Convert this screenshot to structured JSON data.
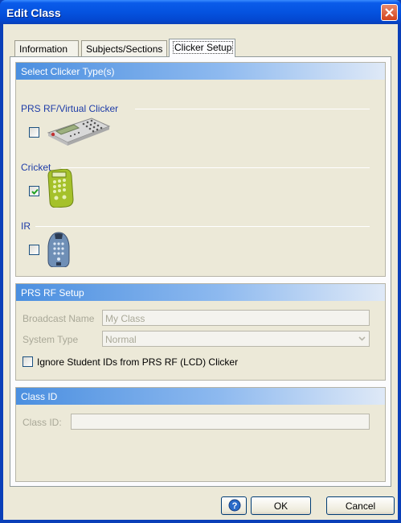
{
  "window": {
    "title": "Edit Class"
  },
  "tabs": [
    {
      "label": "Information"
    },
    {
      "label": "Subjects/Sections"
    },
    {
      "label": "Clicker Setup"
    }
  ],
  "clicker_types": {
    "header": "Select Clicker Type(s)",
    "items": [
      {
        "label": "PRS RF/Virtual Clicker",
        "checked": false,
        "icon": "lcd-clicker-icon"
      },
      {
        "label": "Cricket",
        "checked": true,
        "icon": "cricket-clicker-icon"
      },
      {
        "label": "IR",
        "checked": false,
        "icon": "ir-clicker-icon"
      }
    ]
  },
  "prs_setup": {
    "header": "PRS RF Setup",
    "broadcast_label": "Broadcast Name",
    "broadcast_value": "My Class",
    "system_type_label": "System Type",
    "system_type_value": "Normal",
    "ignore_ids_label": "Ignore Student IDs from PRS RF (LCD) Clicker",
    "ignore_ids_checked": false
  },
  "class_id": {
    "header": "Class ID",
    "label": "Class ID:",
    "value": ""
  },
  "buttons": {
    "ok": "OK",
    "cancel": "Cancel"
  },
  "colors": {
    "title_bar": "#0553e0",
    "group_header": "#4b8fe0",
    "dialog_bg": "#ece9d8"
  }
}
